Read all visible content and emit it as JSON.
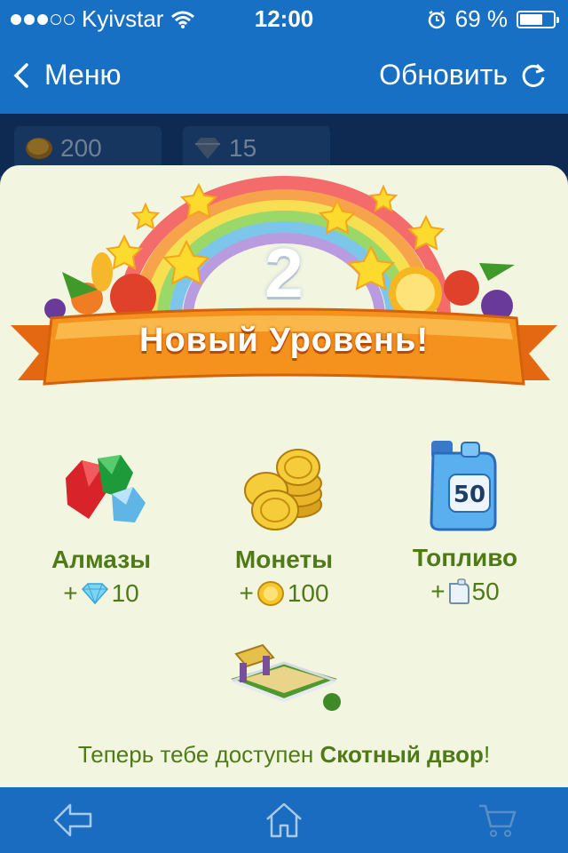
{
  "status_bar": {
    "carrier": "Kyivstar",
    "time": "12:00",
    "battery": "69 %",
    "battery_level": 0.69,
    "signal_bars_filled": 3,
    "signal_bars_total": 5
  },
  "nav": {
    "back_label": "Меню",
    "refresh_label": "Обновить",
    "back_icon": "chevron-left-icon",
    "refresh_icon": "refresh-icon"
  },
  "balances": {
    "coins": "200",
    "diamonds": "15"
  },
  "level_up": {
    "level_number": "2",
    "banner_title": "Новый Уровень!"
  },
  "rewards": [
    {
      "name": "Алмазы",
      "amount": "+",
      "value": "10",
      "icon": "diamond-icon"
    },
    {
      "name": "Монеты",
      "amount": "+",
      "value": "100",
      "icon": "coin-icon"
    },
    {
      "name": "Топливо",
      "amount": "+",
      "value": "50",
      "icon": "fuel-canister-icon",
      "canister_label": "50"
    }
  ],
  "unlock": {
    "prefix": "Теперь тебе доступен ",
    "building": "Скотный двор",
    "suffix": "!"
  },
  "tab_bar": {
    "items": [
      "back-arrow-icon",
      "home-icon",
      "cart-icon"
    ]
  },
  "colors": {
    "nav_blue": "#1870c4",
    "panel_bg": "#f2f6e0",
    "reward_green": "#4f7a18",
    "banner_orange": "#f07a1a"
  }
}
